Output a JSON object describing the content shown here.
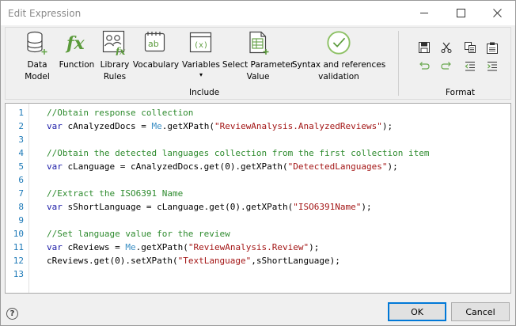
{
  "window": {
    "title": "Edit Expression"
  },
  "ribbon": {
    "buttons": [
      {
        "id": "data-model",
        "line1": "Data",
        "line2": "Model"
      },
      {
        "id": "function",
        "line1": "Function",
        "line2": ""
      },
      {
        "id": "library-rules",
        "line1": "Library",
        "line2": "Rules"
      },
      {
        "id": "vocabulary",
        "line1": "Vocabulary",
        "line2": ""
      },
      {
        "id": "variables",
        "line1": "Variables",
        "line2": "▾"
      },
      {
        "id": "select-parameter-value",
        "line1": "Select Parameter",
        "line2": "Value"
      },
      {
        "id": "syntax-validation",
        "line1": "Syntax and references",
        "line2": "validation"
      }
    ],
    "include_group_label": "Include",
    "format_group_label": "Format"
  },
  "editor": {
    "line_numbers": [
      "1",
      "2",
      "3",
      "4",
      "5",
      "6",
      "7",
      "8",
      "9",
      "10",
      "11",
      "12",
      "13"
    ],
    "lines": [
      [
        {
          "t": "//Obtain response collection",
          "c": "comment"
        }
      ],
      [
        {
          "t": "var",
          "c": "kw"
        },
        {
          "t": " cAnalyzedDocs = ",
          "c": "plain"
        },
        {
          "t": "Me",
          "c": "me"
        },
        {
          "t": ".getXPath(",
          "c": "plain"
        },
        {
          "t": "\"ReviewAnalysis.AnalyzedReviews\"",
          "c": "str"
        },
        {
          "t": ");",
          "c": "plain"
        }
      ],
      [],
      [
        {
          "t": "//Obtain the detected languages collection from the first collection item",
          "c": "comment"
        }
      ],
      [
        {
          "t": "var",
          "c": "kw"
        },
        {
          "t": " cLanguage = cAnalyzedDocs.get(",
          "c": "plain"
        },
        {
          "t": "0",
          "c": "plain"
        },
        {
          "t": ").getXPath(",
          "c": "plain"
        },
        {
          "t": "\"DetectedLanguages\"",
          "c": "str"
        },
        {
          "t": ");",
          "c": "plain"
        }
      ],
      [],
      [
        {
          "t": "//Extract the ISO6391 Name",
          "c": "comment"
        }
      ],
      [
        {
          "t": "var",
          "c": "kw"
        },
        {
          "t": " sShortLanguage = cLanguage.get(",
          "c": "plain"
        },
        {
          "t": "0",
          "c": "plain"
        },
        {
          "t": ").getXPath(",
          "c": "plain"
        },
        {
          "t": "\"ISO6391Name\"",
          "c": "str"
        },
        {
          "t": ");",
          "c": "plain"
        }
      ],
      [],
      [
        {
          "t": "//Set language value for the review",
          "c": "comment"
        }
      ],
      [
        {
          "t": "var",
          "c": "kw"
        },
        {
          "t": " cReviews = ",
          "c": "plain"
        },
        {
          "t": "Me",
          "c": "me"
        },
        {
          "t": ".getXPath(",
          "c": "plain"
        },
        {
          "t": "\"ReviewAnalysis.Review\"",
          "c": "str"
        },
        {
          "t": ");",
          "c": "plain"
        }
      ],
      [
        {
          "t": "cReviews.get(",
          "c": "plain"
        },
        {
          "t": "0",
          "c": "plain"
        },
        {
          "t": ").setXPath(",
          "c": "plain"
        },
        {
          "t": "\"TextLanguage\"",
          "c": "str"
        },
        {
          "t": ",sShortLanguage);",
          "c": "plain"
        }
      ],
      []
    ]
  },
  "footer": {
    "help_label": "?",
    "ok_label": "OK",
    "cancel_label": "Cancel"
  },
  "colors": {
    "line_number": "#1e7ab8",
    "comment": "#2e8b2e",
    "keyword": "#1a1aa6",
    "string": "#a31515",
    "accent": "#0078d7"
  }
}
